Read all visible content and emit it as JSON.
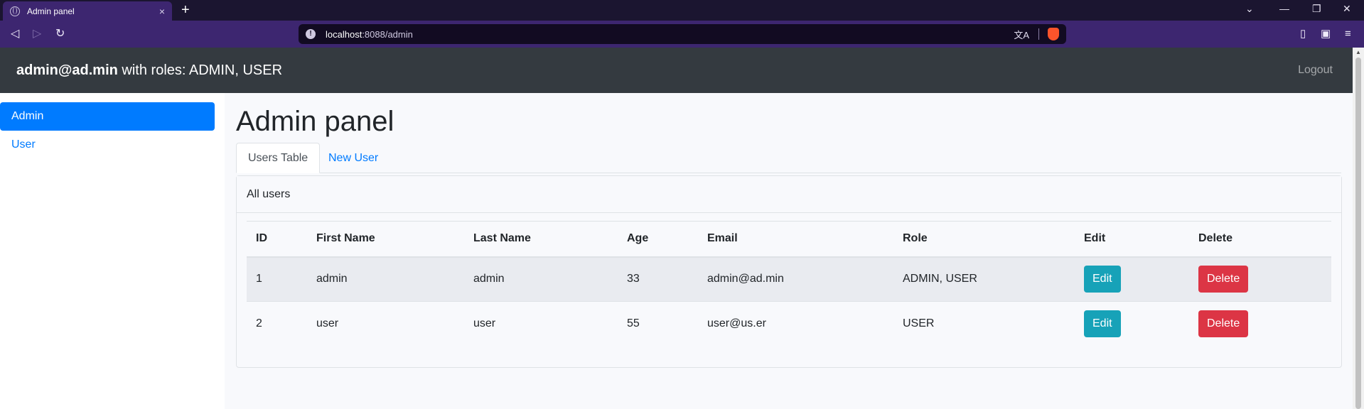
{
  "browser": {
    "tab_title": "Admin panel",
    "tab_close": "×",
    "new_tab": "+",
    "url_host": "localhost",
    "url_rest": ":8088/admin",
    "back": "◁",
    "forward": "▷",
    "reload": "↻",
    "win_dropdown": "⌄",
    "win_minimize": "—",
    "win_restore": "❐",
    "win_close": "✕",
    "translate": "文A",
    "sidebar_toggle": "▯",
    "wallet": "▣",
    "menu": "≡"
  },
  "navbar": {
    "email": "admin@ad.min",
    "roles_text": " with roles: ADMIN, USER",
    "logout": "Logout"
  },
  "sidebar": {
    "items": [
      {
        "label": "Admin",
        "active": true
      },
      {
        "label": "User",
        "active": false
      }
    ]
  },
  "main": {
    "title": "Admin panel",
    "tabs": [
      {
        "label": "Users Table",
        "active": true
      },
      {
        "label": "New User",
        "active": false
      }
    ],
    "card_header": "All users",
    "table": {
      "columns": [
        "ID",
        "First Name",
        "Last Name",
        "Age",
        "Email",
        "Role",
        "Edit",
        "Delete"
      ],
      "rows": [
        {
          "id": "1",
          "first_name": "admin",
          "last_name": "admin",
          "age": "33",
          "email": "admin@ad.min",
          "role": "ADMIN, USER",
          "edit": "Edit",
          "delete": "Delete"
        },
        {
          "id": "2",
          "first_name": "user",
          "last_name": "user",
          "age": "55",
          "email": "user@us.er",
          "role": "USER",
          "edit": "Edit",
          "delete": "Delete"
        }
      ]
    }
  },
  "colors": {
    "primary": "#007bff",
    "navbar": "#343a40",
    "edit_button": "#17a2b8",
    "delete_button": "#dc3545",
    "browser_toolbar": "#3d2670"
  }
}
